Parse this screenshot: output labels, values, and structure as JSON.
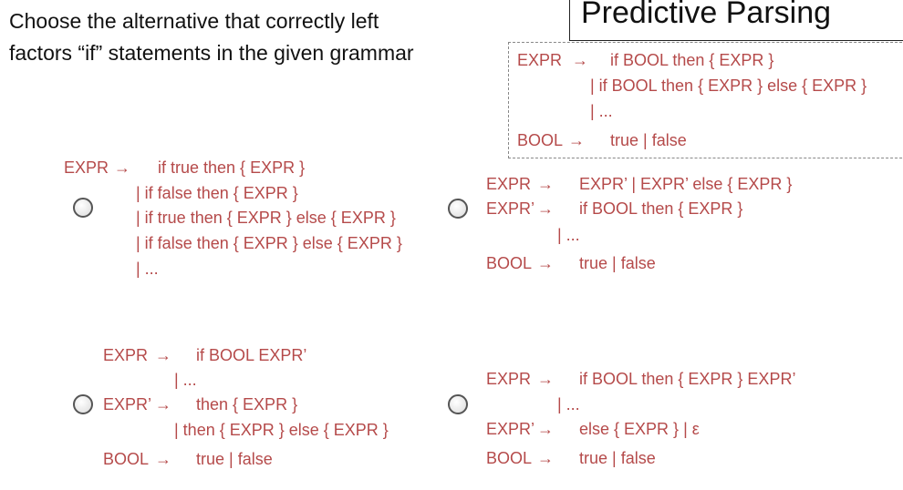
{
  "question": {
    "line1": "Choose the alternative that correctly left",
    "line2": "factors “if” statements in the given grammar"
  },
  "title": "Predictive Parsing",
  "given_grammar": {
    "lhs_expr": "EXPR",
    "lhs_bool": "BOOL",
    "arrow": "→",
    "rhs1": "if BOOL then { EXPR }",
    "rhs2": "|  if BOOL then { EXPR } else { EXPR }",
    "rhs3": "|  ...",
    "bool_rhs": "true | false"
  },
  "options": [
    {
      "lhs": "EXPR",
      "arrow": "→",
      "rhs": [
        "if true then { EXPR }",
        "|  if false then { EXPR }",
        "|  if true then { EXPR } else { EXPR }",
        "|  if false then { EXPR } else { EXPR }",
        "|  ..."
      ]
    },
    {
      "lhs1": "EXPR",
      "lhs2": "EXPR’",
      "lhs3": "BOOL",
      "arrow": "→",
      "rhs1": "EXPR’ | EXPR’ else { EXPR }",
      "rhs2": "if BOOL then { EXPR }",
      "rhs3": "|  ...",
      "rhs4": "true | false"
    },
    {
      "lhs1": "EXPR",
      "lhs2": "EXPR’",
      "lhs3": "BOOL",
      "arrow": "→",
      "rhs1": "if BOOL EXPR’",
      "rhs2": "|  ...",
      "rhs3": "then { EXPR }",
      "rhs4": "|  then { EXPR } else { EXPR }",
      "rhs5": "true | false"
    },
    {
      "lhs1": "EXPR",
      "lhs2": "EXPR’",
      "lhs3": "BOOL",
      "arrow": "→",
      "rhs1": "if BOOL then { EXPR } EXPR’",
      "rhs2": "|  ...",
      "rhs3": "else { EXPR } | ε",
      "rhs4": "true | false"
    }
  ]
}
